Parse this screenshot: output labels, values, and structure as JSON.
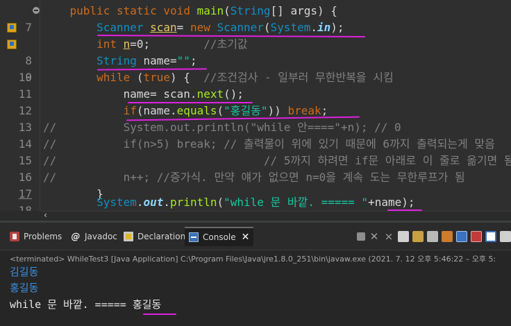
{
  "editor": {
    "lines": [
      {
        "num": "7",
        "fold": true
      },
      {
        "num": "8",
        "marker": true
      },
      {
        "num": "9",
        "marker": true
      },
      {
        "num": "10"
      },
      {
        "num": "11"
      },
      {
        "num": "12"
      },
      {
        "num": "13"
      },
      {
        "num": "14"
      },
      {
        "num": "15"
      },
      {
        "num": "16"
      },
      {
        "num": "17",
        "underline": true
      },
      {
        "num": "18"
      },
      {
        "num": "19"
      }
    ],
    "code": {
      "l7": {
        "kw1": "public",
        "kw2": "static",
        "kw3": "void",
        "fn": "main",
        "p1": "(",
        "ty": "String",
        "p2": "[] args) {"
      },
      "l8": {
        "ty1": "Scanner",
        "va": "scan",
        "op": "= ",
        "kw": "new",
        "ty2": "Scanner",
        "p1": "(",
        "ty3": "System",
        "dot": ".",
        "it": "in",
        "p2": ");"
      },
      "l9": {
        "kw": "int",
        "va": "n",
        "p": "=0;",
        "cm": "//초기값"
      },
      "l10": {
        "ty": "String",
        "va": "name",
        "p1": "=",
        "st": "\"\"",
        "p2": ";"
      },
      "l11": {
        "kw1": "while",
        "p1": " (",
        "kw2": "true",
        "p2": ") {",
        "cm": "//조건검사 - 일부러 무한반복을 시킴"
      },
      "l12": {
        "va1": "name",
        "p1": "= ",
        "va2": "scan",
        "p2": ".",
        "fn": "next",
        "p3": "();"
      },
      "l13": {
        "kw1": "if",
        "p1": "(",
        "va": "name",
        "p2": ".",
        "fn": "equals",
        "p3": "(",
        "st": "\"홍길동\"",
        "p4": ")) ",
        "kw2": "break",
        "p5": ";"
      },
      "l14": {
        "cm": "//          System.out.println(\"while 안====\"+n); // 0"
      },
      "l15": {
        "cm": "//          if(n>5) break; // 출력물이 위에 있기 때문에 6까지 출력되는게 맞음"
      },
      "l16": {
        "cm": "//                               // 5까지 하려면 if문 아래로 이 줄로 옮기면 됨"
      },
      "l17": {
        "cm": "//          n++; //증가식. 만약 얘가 없으면 n=0을 계속 도는 무한루프가 됨"
      },
      "l18": {
        "p": "}"
      },
      "l19": {
        "ty": "System",
        "dot": ".",
        "it": "out",
        "p1": ".",
        "fn": "println",
        "p2": "(",
        "st": "\"while 문 바깥. ===== \"",
        "op": "+",
        "va": "name",
        "p3": ");"
      }
    },
    "scroll_arrow": "‹"
  },
  "tabs": {
    "problems": "Problems",
    "javadoc": "Javadoc",
    "declaration": "Declaration",
    "console": "Console"
  },
  "console": {
    "terminated": "<terminated> WhileTest3 [Java Application] C:\\Program Files\\Java\\jre1.8.0_251\\bin\\javaw.exe  (2021. 7. 12 오후 5:46:22 – 오후 5:",
    "output": [
      "김길동",
      "홍길동",
      "while 문 바깥. ===== 홍길동"
    ]
  },
  "colors": {
    "keyword": "#cc6c1d",
    "type": "#1290c3",
    "string": "#17c6a3",
    "comment": "#808080",
    "method": "#a7ec21",
    "variable": "#e4c85e",
    "annotation_underline": "#e020e0",
    "console_input": "#3b8fdd"
  }
}
